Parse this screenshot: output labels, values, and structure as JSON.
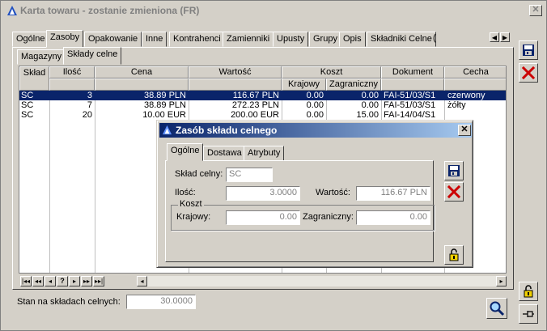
{
  "window": {
    "title": "Karta towaru - zostanie zmieniona (FR)",
    "close_glyph": "✕"
  },
  "tabs": [
    {
      "label": "Ogólne"
    },
    {
      "label": "Zasoby"
    },
    {
      "label": "Opakowanie"
    },
    {
      "label": "Inne"
    },
    {
      "label": "Kontrahenci"
    },
    {
      "label": "Zamienniki"
    },
    {
      "label": "Upusty"
    },
    {
      "label": "Grupy"
    },
    {
      "label": "Opis"
    },
    {
      "label": "Składniki Celne"
    },
    {
      "label": "("
    }
  ],
  "subtabs": [
    {
      "label": "Magazyny"
    },
    {
      "label": "Składy celne"
    }
  ],
  "table": {
    "headers": {
      "sklad": "Skład",
      "ilosc": "Ilość",
      "cena": "Cena",
      "wartosc": "Wartość",
      "koszt": "Koszt",
      "krajowy": "Krajowy",
      "zagraniczny": "Zagraniczny",
      "dokument": "Dokument",
      "cecha": "Cecha"
    },
    "rows": [
      {
        "sklad": "SC",
        "ilosc": "3",
        "cena": "38.89 PLN",
        "wartosc": "116.67 PLN",
        "krajowy": "0.00",
        "zagraniczny": "0.00",
        "dokument": "FAI-51/03/S1",
        "cecha": "czerwony"
      },
      {
        "sklad": "SC",
        "ilosc": "7",
        "cena": "38.89 PLN",
        "wartosc": "272.23 PLN",
        "krajowy": "0.00",
        "zagraniczny": "0.00",
        "dokument": "FAI-51/03/S1",
        "cecha": "żółty"
      },
      {
        "sklad": "SC",
        "ilosc": "20",
        "cena": "10.00 EUR",
        "wartosc": "200.00 EUR",
        "krajowy": "0.00",
        "zagraniczny": "15.00",
        "dokument": "FAI-14/04/S1",
        "cecha": ""
      }
    ]
  },
  "nav": {
    "first": "|◂◂",
    "prev_page": "◂◂",
    "prev": "◂",
    "help": "?",
    "next": "▸",
    "next_page": "▸▸",
    "last": "▸▸|",
    "scroll_left": "◂",
    "scroll_right": "▸"
  },
  "footer": {
    "label": "Stan na składach celnych:",
    "value": "30.0000"
  },
  "dialog": {
    "title": "Zasób składu celnego",
    "tabs": [
      {
        "label": "Ogólne"
      },
      {
        "label": "Dostawa"
      },
      {
        "label": "Atrybuty"
      }
    ],
    "sklad_label": "Skład celny:",
    "sklad_value": "SC",
    "ilosc_label": "Ilość:",
    "ilosc_value": "3.0000",
    "wartosc_label": "Wartość:",
    "wartosc_value": "116.67 PLN",
    "koszt_group": "Koszt",
    "krajowy_label": "Krajowy:",
    "krajowy_value": "0.00",
    "zagraniczny_label": "Zagraniczny:",
    "zagraniczny_value": "0.00"
  },
  "colors": {
    "selection": "#0a246a",
    "save_icon": "#0a246a",
    "cancel_icon": "#cc0000",
    "lock_icon": "#f0d000"
  }
}
